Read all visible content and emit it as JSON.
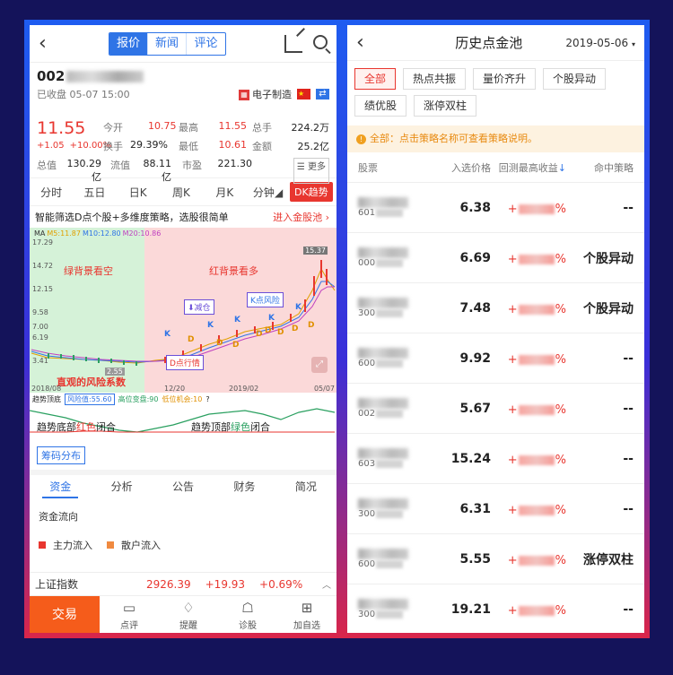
{
  "left": {
    "header": {
      "tabs": [
        "报价",
        "新闻",
        "评论"
      ],
      "active_tab": 0
    },
    "stock": {
      "code_prefix": "002",
      "status": "已收盘 05-07 15:00",
      "sector_tag": "电子制造",
      "price": "11.55",
      "change": "+1.05",
      "change_pct": "+10.00%",
      "stats": [
        {
          "label": "今开",
          "value": "10.75"
        },
        {
          "label": "最高",
          "value": "11.55"
        },
        {
          "label": "总手",
          "value": "224.2万"
        },
        {
          "label": "换手",
          "value": "29.39%"
        },
        {
          "label": "最低",
          "value": "10.61"
        },
        {
          "label": "金额",
          "value": "25.2亿"
        },
        {
          "label": "总值",
          "value": "130.29亿"
        },
        {
          "label": "流值",
          "value": "88.11亿"
        },
        {
          "label": "市盈",
          "value": "221.30"
        }
      ],
      "more_label": "更多"
    },
    "kline_tabs": [
      "分时",
      "五日",
      "日K",
      "周K",
      "月K",
      "分钟",
      "DK趋势"
    ],
    "smart_text": "智能筛选D点个股+多维度策略，选股很简单",
    "smart_link": "进入金股池",
    "chart": {
      "ma_label": "MA",
      "ma5": "M5:11.87",
      "ma10": "M10:12.80",
      "ma20": "M20:10.86",
      "y_labels": [
        "17.29",
        "14.72",
        "12.15",
        "9.58",
        "7.00",
        "6.19",
        "3.41"
      ],
      "peak_label": "15.37",
      "low_label": "2.55",
      "annotations": {
        "green_zone": "绿背景看空",
        "red_zone": "红背景看多",
        "risk": "直观的风险系数",
        "reduce": "减仓",
        "d_point": "D点行情",
        "k_risk": "K点风险"
      },
      "x_labels": [
        "2018/08",
        "12/20",
        "2019/02",
        "05/07"
      ],
      "k_marks": [
        "K",
        "K",
        "K",
        "K",
        "K"
      ],
      "d_marks": [
        "D",
        "D",
        "D",
        "D",
        "D",
        "D",
        "D",
        "D"
      ],
      "risk_label": "趋势顶底",
      "risk_value": "风险值:55.60",
      "high_label": "高位变盘:90",
      "low_opp": "低位机会:10",
      "help": "?"
    },
    "osc": {
      "bottom_a": "趋势底部",
      "bottom_b": "红色",
      "bottom_c": "闭合",
      "top_a": "趋势顶部",
      "top_b": "绿色",
      "top_c": "闭合"
    },
    "chip_btn": "筹码分布",
    "fund_tabs": [
      "资金",
      "分析",
      "公告",
      "财务",
      "简况"
    ],
    "flow_title": "资金流向",
    "legend": [
      {
        "label": "主力流入",
        "color": "#e8362f"
      },
      {
        "label": "散户流入",
        "color": "#f08a40"
      }
    ],
    "index": {
      "name": "上证指数",
      "value": "2926.39",
      "change": "+19.93",
      "pct": "+0.69%"
    },
    "nav": {
      "trade": "交易",
      "items": [
        {
          "label": "点评",
          "icon": "comment-icon"
        },
        {
          "label": "提醒",
          "icon": "bell-icon"
        },
        {
          "label": "诊股",
          "icon": "robot-icon"
        },
        {
          "label": "加自选",
          "icon": "plus-icon"
        }
      ]
    }
  },
  "right": {
    "title": "历史点金池",
    "date": "2019-05-06",
    "filters": [
      "全部",
      "热点共振",
      "量价齐升",
      "个股异动",
      "绩优股",
      "涨停双柱"
    ],
    "active_filter": 0,
    "notice": "全部：点击策略名称可查看策略说明。",
    "columns": [
      "股票",
      "入选价格",
      "回测最高收益",
      "命中策略"
    ],
    "rows": [
      {
        "code": "601",
        "price": "6.38",
        "gain_prefix": "+",
        "gain_suffix": "%",
        "strategy": "--"
      },
      {
        "code": "000",
        "price": "6.69",
        "gain_prefix": "+",
        "gain_suffix": "%",
        "strategy": "个股异动"
      },
      {
        "code": "300",
        "price": "7.48",
        "gain_prefix": "+",
        "gain_suffix": "%",
        "strategy": "个股异动"
      },
      {
        "code": "600",
        "price": "9.92",
        "gain_prefix": "+",
        "gain_suffix": "%",
        "strategy": "--"
      },
      {
        "code": "002",
        "price": "5.67",
        "gain_prefix": "+",
        "gain_suffix": "%",
        "strategy": "--"
      },
      {
        "code": "603",
        "price": "15.24",
        "gain_prefix": "+",
        "gain_suffix": "%",
        "strategy": "--"
      },
      {
        "code": "300",
        "price": "6.31",
        "gain_prefix": "+",
        "gain_suffix": "%",
        "strategy": "--"
      },
      {
        "code": "600",
        "price": "5.55",
        "gain_prefix": "+",
        "gain_suffix": "%",
        "strategy": "涨停双柱"
      },
      {
        "code": "300",
        "price": "19.21",
        "gain_prefix": "+",
        "gain_suffix": "%",
        "strategy": "--"
      }
    ]
  }
}
